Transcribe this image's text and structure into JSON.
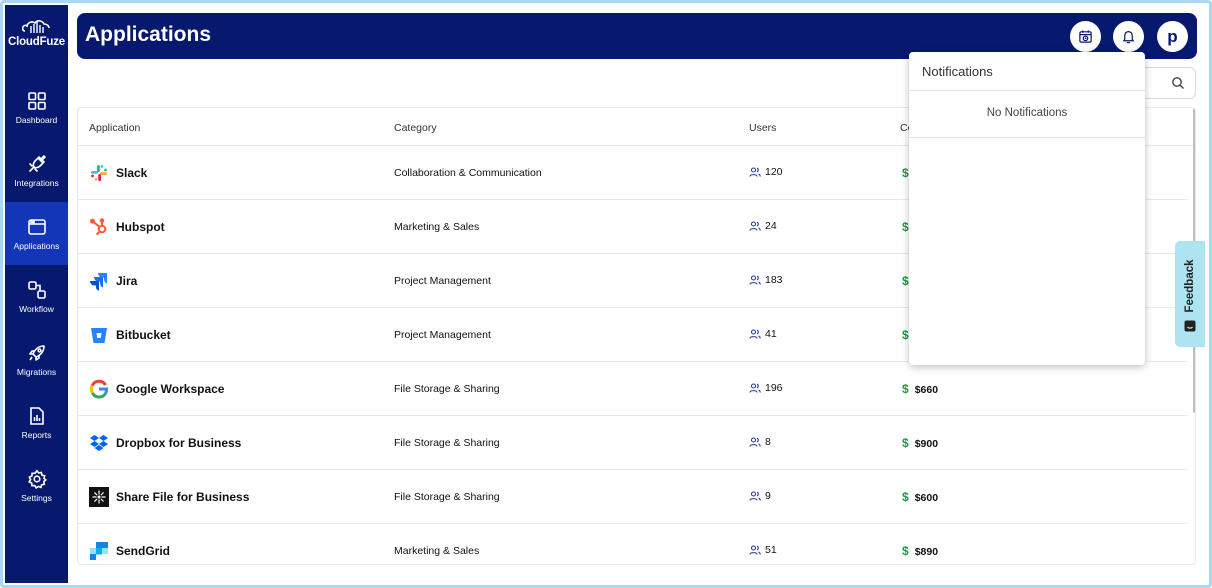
{
  "brand": {
    "name": "CloudFuze"
  },
  "sidebar": {
    "items": [
      {
        "label": "Dashboard",
        "icon": "dashboard-icon"
      },
      {
        "label": "Integrations",
        "icon": "plug-icon"
      },
      {
        "label": "Applications",
        "icon": "window-icon",
        "active": true
      },
      {
        "label": "Workflow",
        "icon": "workflow-icon"
      },
      {
        "label": "Migrations",
        "icon": "rocket-icon"
      },
      {
        "label": "Reports",
        "icon": "report-icon"
      },
      {
        "label": "Settings",
        "icon": "gear-icon"
      }
    ]
  },
  "header": {
    "title": "Applications",
    "avatar_letter": "p"
  },
  "table": {
    "columns": {
      "application": "Application",
      "category": "Category",
      "users": "Users",
      "cost": "Co"
    },
    "rows": [
      {
        "name": "Slack",
        "category": "Collaboration & Communication",
        "users": "120",
        "cost": ""
      },
      {
        "name": "Hubspot",
        "category": "Marketing & Sales",
        "users": "24",
        "cost": ""
      },
      {
        "name": "Jira",
        "category": "Project Management",
        "users": "183",
        "cost": ""
      },
      {
        "name": "Bitbucket",
        "category": "Project Management",
        "users": "41",
        "cost": ""
      },
      {
        "name": "Google Workspace",
        "category": "File Storage & Sharing",
        "users": "196",
        "cost": "$660"
      },
      {
        "name": "Dropbox for Business",
        "category": "File Storage & Sharing",
        "users": "8",
        "cost": "$900"
      },
      {
        "name": "Share File for Business",
        "category": "File Storage & Sharing",
        "users": "9",
        "cost": "$600"
      },
      {
        "name": "SendGrid",
        "category": "Marketing & Sales",
        "users": "51",
        "cost": "$890"
      }
    ]
  },
  "notifications": {
    "title": "Notifications",
    "empty_text": "No Notifications"
  },
  "feedback": {
    "label": "Feedback"
  },
  "colors": {
    "primary": "#06196e",
    "active": "#1336b8",
    "money": "#1c9a45",
    "feedback_bg": "#aee3f2"
  }
}
